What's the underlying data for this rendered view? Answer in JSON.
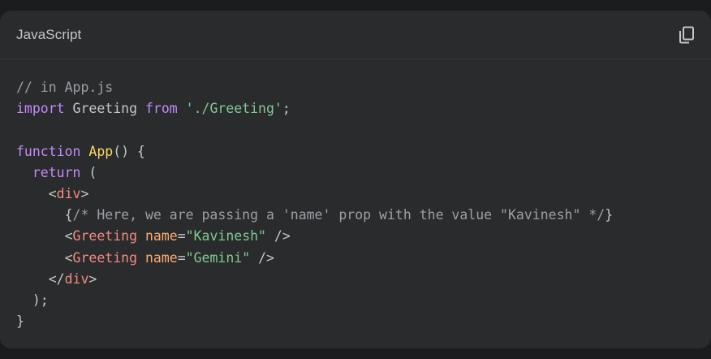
{
  "header": {
    "language": "JavaScript",
    "copy_icon": "copy-icon"
  },
  "code": {
    "lines": [
      [
        {
          "t": "// in App.js",
          "c": "comment"
        }
      ],
      [
        {
          "t": "import",
          "c": "keyword"
        },
        {
          "t": " Greeting ",
          "c": "plain"
        },
        {
          "t": "from",
          "c": "keyword"
        },
        {
          "t": " ",
          "c": "plain"
        },
        {
          "t": "'./Greeting'",
          "c": "string"
        },
        {
          "t": ";",
          "c": "plain"
        }
      ],
      [],
      [
        {
          "t": "function",
          "c": "keyword"
        },
        {
          "t": " ",
          "c": "plain"
        },
        {
          "t": "App",
          "c": "func"
        },
        {
          "t": "() {",
          "c": "plain"
        }
      ],
      [
        {
          "t": "  ",
          "c": "plain"
        },
        {
          "t": "return",
          "c": "keyword"
        },
        {
          "t": " (",
          "c": "plain"
        }
      ],
      [
        {
          "t": "    <",
          "c": "plain"
        },
        {
          "t": "div",
          "c": "tag"
        },
        {
          "t": ">",
          "c": "plain"
        }
      ],
      [
        {
          "t": "      {",
          "c": "plain"
        },
        {
          "t": "/* Here, we are passing a 'name' prop with the value \"Kavinesh\" */",
          "c": "comment"
        },
        {
          "t": "}",
          "c": "plain"
        }
      ],
      [
        {
          "t": "      <",
          "c": "plain"
        },
        {
          "t": "Greeting",
          "c": "tag"
        },
        {
          "t": " ",
          "c": "plain"
        },
        {
          "t": "name",
          "c": "attr"
        },
        {
          "t": "=",
          "c": "plain"
        },
        {
          "t": "\"Kavinesh\"",
          "c": "string"
        },
        {
          "t": " />",
          "c": "plain"
        }
      ],
      [
        {
          "t": "      <",
          "c": "plain"
        },
        {
          "t": "Greeting",
          "c": "tag"
        },
        {
          "t": " ",
          "c": "plain"
        },
        {
          "t": "name",
          "c": "attr"
        },
        {
          "t": "=",
          "c": "plain"
        },
        {
          "t": "\"Gemini\"",
          "c": "string"
        },
        {
          "t": " />",
          "c": "plain"
        }
      ],
      [
        {
          "t": "    </",
          "c": "plain"
        },
        {
          "t": "div",
          "c": "tag"
        },
        {
          "t": ">",
          "c": "plain"
        }
      ],
      [
        {
          "t": "  );",
          "c": "plain"
        }
      ],
      [
        {
          "t": "}",
          "c": "plain"
        }
      ]
    ]
  },
  "colors": {
    "page_background": "#1b1c1d",
    "card_background": "#2a2b2d",
    "comment": "#9aa0a6",
    "keyword": "#c58af9",
    "string": "#81c995",
    "function_name": "#fdd663",
    "tag": "#f28b82",
    "attribute": "#fcad70"
  }
}
